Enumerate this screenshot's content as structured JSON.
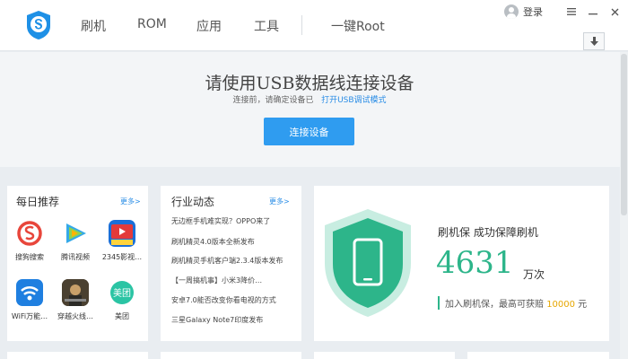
{
  "nav": {
    "items": [
      "刷机",
      "ROM",
      "应用",
      "工具"
    ],
    "root_label": "一键Root",
    "login_label": "登录"
  },
  "connect": {
    "title": "请使用USB数据线连接设备",
    "subtitle_prefix": "连接前，请确定设备已",
    "subtitle_link": "打开USB调试模式",
    "button_label": "连接设备"
  },
  "daily": {
    "title": "每日推荐",
    "more_label": "更多>",
    "apps": [
      {
        "name": "搜狗搜索",
        "icon": "sogou-search-icon"
      },
      {
        "name": "腾讯视频",
        "icon": "tencent-video-icon"
      },
      {
        "name": "2345影视…",
        "icon": "2345-video-icon"
      },
      {
        "name": "WiFi万能…",
        "icon": "wifi-key-icon"
      },
      {
        "name": "穿越火线…",
        "icon": "crossfire-game-icon"
      },
      {
        "name": "美团",
        "icon": "meituan-icon"
      }
    ]
  },
  "news": {
    "title": "行业动态",
    "more_label": "更多>",
    "items": [
      "无边框手机难实现？OPPO来了",
      "刷机精灵4.0版本全新发布",
      "刷机精灵手机客户端2.3.4版本发布",
      "【一周搞机事】小米3降价…",
      "安卓7.0能否改变你看电视的方式",
      "三星Galaxy Note7印度发布"
    ]
  },
  "protect": {
    "title": "刷机保  成功保障刷机",
    "count": "4631",
    "unit": "万次",
    "note_prefix": "加入刷机保，最高可获赔 ",
    "note_amount": "10000",
    "note_suffix": " 元"
  },
  "colors": {
    "accent_blue": "#2f9cf0",
    "link_blue": "#2a8de6",
    "protect_green": "#2db58a",
    "amount_orange": "#e6a700"
  }
}
